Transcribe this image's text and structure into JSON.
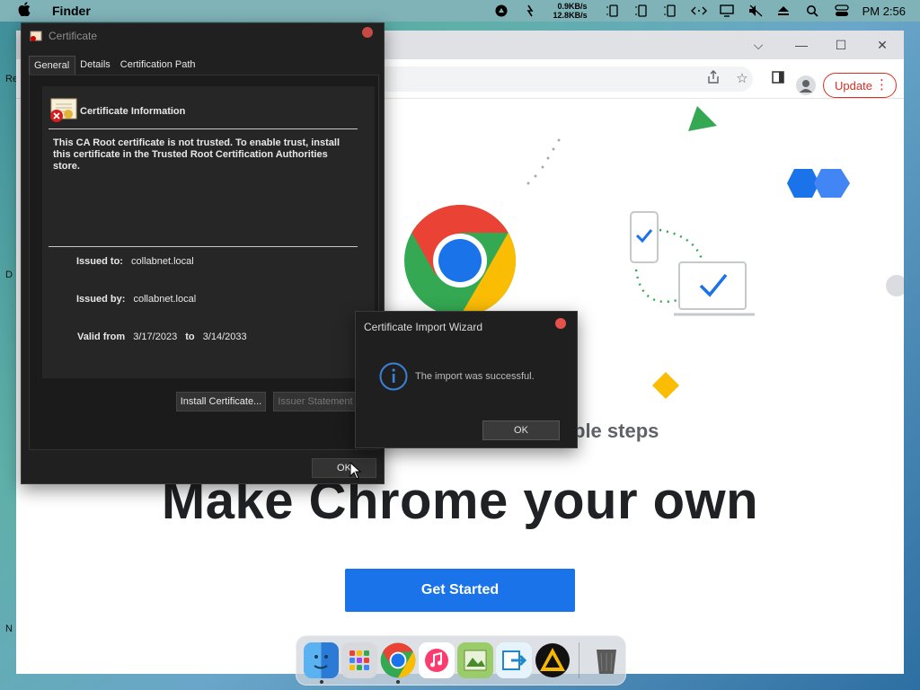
{
  "menubar": {
    "app_name": "Finder",
    "net_up": "0.9KB/s",
    "net_down": "12.8KB/s",
    "clock": "PM 2:56",
    "icons": [
      "apple-icon",
      "record-icon",
      "signal-icon",
      "battery-icon",
      "battery-icon",
      "battery-icon",
      "code-icon",
      "display-icon",
      "mute-icon",
      "eject-icon",
      "search-icon",
      "control-center-icon"
    ]
  },
  "desktop": {
    "edge_labels": [
      "Re",
      "D",
      "N"
    ]
  },
  "chrome": {
    "update_label": "Update",
    "subtitle": "ple steps",
    "headline": "Make Chrome your own",
    "cta_label": "Get Started",
    "colors": {
      "blue": "#1a73e8",
      "red": "#ea4335",
      "yellow": "#fbbc04",
      "green": "#34a853"
    }
  },
  "certificate": {
    "window_title": "Certificate",
    "tabs": [
      "General",
      "Details",
      "Certification Path"
    ],
    "active_tab": "General",
    "info_heading": "Certificate Information",
    "body_text": "This CA Root certificate is not trusted. To enable trust, install this certificate in the Trusted Root Certification Authorities store.",
    "issued_to_label": "Issued to:",
    "issued_to_value": "collabnet.local",
    "issued_by_label": "Issued by:",
    "issued_by_value": "collabnet.local",
    "valid_from_label": "Valid from",
    "valid_from_value": "3/17/2023",
    "valid_to_label": "to",
    "valid_to_value": "3/14/2033",
    "install_button": "Install Certificate...",
    "issuer_button": "Issuer Statement",
    "ok_button": "OK"
  },
  "wizard": {
    "title": "Certificate Import Wizard",
    "message": "The import was successful.",
    "ok_button": "OK"
  },
  "dock": {
    "apps": [
      "finder-icon",
      "launchpad-icon",
      "chrome-icon",
      "music-icon",
      "preview-icon",
      "migration-icon",
      "vlc-icon",
      "trash-icon"
    ]
  }
}
